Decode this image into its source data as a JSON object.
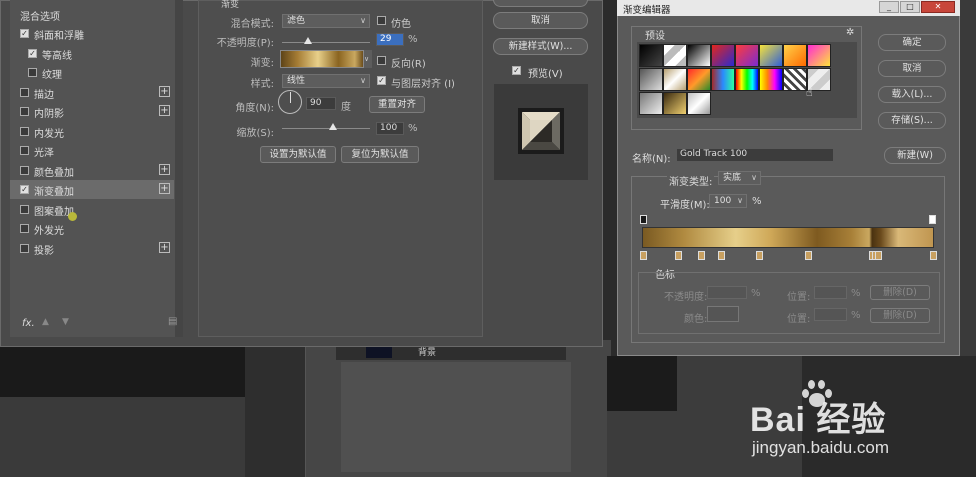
{
  "layer_style": {
    "section_header": "混合选项",
    "styles": [
      {
        "label": "斜面和浮雕",
        "checked": true,
        "plus": false,
        "indent": 0
      },
      {
        "label": "等高线",
        "checked": true,
        "plus": false,
        "indent": 1
      },
      {
        "label": "纹理",
        "checked": false,
        "plus": false,
        "indent": 1
      },
      {
        "label": "描边",
        "checked": false,
        "plus": true,
        "indent": 0
      },
      {
        "label": "内阴影",
        "checked": false,
        "plus": true,
        "indent": 0
      },
      {
        "label": "内发光",
        "checked": false,
        "plus": false,
        "indent": 0
      },
      {
        "label": "光泽",
        "checked": false,
        "plus": false,
        "indent": 0
      },
      {
        "label": "颜色叠加",
        "checked": false,
        "plus": true,
        "indent": 0
      },
      {
        "label": "渐变叠加",
        "checked": true,
        "plus": true,
        "indent": 0,
        "selected": true
      },
      {
        "label": "图案叠加",
        "checked": false,
        "plus": false,
        "indent": 0
      },
      {
        "label": "外发光",
        "checked": false,
        "plus": false,
        "indent": 0
      },
      {
        "label": "投影",
        "checked": false,
        "plus": true,
        "indent": 0
      }
    ],
    "fx_label": "fx.",
    "panel_title": "渐变",
    "blend_mode_label": "混合模式:",
    "blend_mode_value": "滤色",
    "dither_label": "仿色",
    "opacity_label": "不透明度(P):",
    "opacity_value": "29",
    "opacity_unit": "%",
    "opacity_level": 0.29,
    "gradient_label": "渐变:",
    "reverse_label": "反向(R)",
    "style_label": "样式:",
    "style_value": "线性",
    "align_label": "与图层对齐 (I)",
    "angle_label": "角度(N):",
    "angle_value": "90",
    "angle_unit": "度",
    "reset_align_button": "重置对齐",
    "scale_label": "缩放(S):",
    "scale_value": "100",
    "scale_unit": "%",
    "scale_level": 1.0,
    "set_default_button": "设置为默认值",
    "reset_default_button": "复位为默认值",
    "cancel_button": "取消",
    "new_style_button": "新建样式(W)...",
    "preview_label": "预览(V)",
    "preview_checked": true
  },
  "gradient_editor": {
    "title": "渐变编辑器",
    "presets_label": "预设",
    "ok_button": "确定",
    "cancel_button": "取消",
    "load_button": "载入(L)...",
    "save_button": "存储(S)...",
    "name_label": "名称(N):",
    "name_value": "Gold Track 100",
    "new_button": "新建(W)",
    "gradient_type_label": "渐变类型:",
    "gradient_type_value": "实底",
    "smoothness_label": "平滑度(M):",
    "smoothness_value": "100",
    "smoothness_unit": "%",
    "stops_label": "色标",
    "opacity_label": "不透明度:",
    "opacity_unit": "%",
    "location_label": "位置:",
    "location_unit": "%",
    "delete_button": "删除(D)",
    "color_label": "颜色:",
    "location2_label": "位置:",
    "location2_unit": "%",
    "delete2_button": "删除(D)"
  },
  "layers_panel": {
    "layer_name": "背景"
  },
  "watermark": {
    "brand": "Bai 经验",
    "url": "jingyan.baidu.com"
  }
}
